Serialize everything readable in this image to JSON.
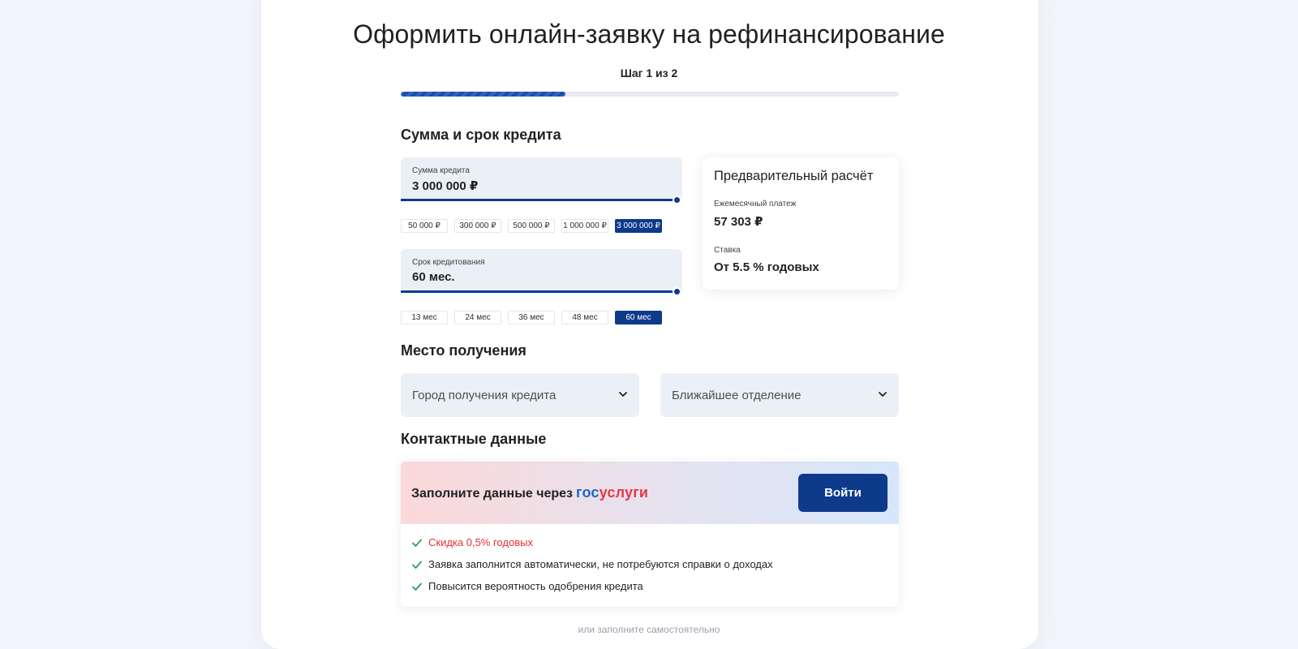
{
  "header": {
    "title": "Оформить онлайн-заявку на рефинансирование",
    "step": "Шаг 1 из 2",
    "progress_fraction": 0.33
  },
  "loan": {
    "section_title": "Сумма и срок кредита",
    "amount": {
      "label": "Сумма кредита",
      "value": "3 000 000 ₽",
      "slider_fraction": 1.0,
      "presets": [
        "50 000 ₽",
        "300 000 ₽",
        "500 000 ₽",
        "1 000 000 ₽",
        "3 000 000 ₽"
      ],
      "selected_preset": "3 000 000 ₽"
    },
    "term": {
      "label": "Срок кредитования",
      "value": "60 мес.",
      "slider_fraction": 1.0,
      "presets": [
        "13 мес",
        "24 мес",
        "36 мес",
        "48 мес",
        "60 мес"
      ],
      "selected_preset": "60 мес"
    }
  },
  "calc": {
    "title": "Предварительный расчёт",
    "monthly_label": "Ежемесячный платеж",
    "monthly_value": "57 303 ₽",
    "rate_label": "Ставка",
    "rate_value": "От 5.5 % годовых"
  },
  "place": {
    "section_title": "Место получения",
    "city_placeholder": "Город получения кредита",
    "branch_placeholder": "Ближайшее отделение"
  },
  "contacts": {
    "section_title": "Контактные данные",
    "gos_prompt": "Заполните данные через",
    "gos_logo_part1": "гос",
    "gos_logo_part2": "услуги",
    "login_button": "Войти",
    "benefits": [
      "Скидка 0,5% годовых",
      "Заявка заполнится автоматически, не потребуются справки о доходах",
      "Повысится вероятность одобрения кредита"
    ],
    "manual_hint": "или заполните самостоятельно"
  },
  "colors": {
    "primary": "#0e3a8c",
    "field_bg": "#ebf0f7",
    "check": "#2e9c5c",
    "discount": "#e53333"
  }
}
